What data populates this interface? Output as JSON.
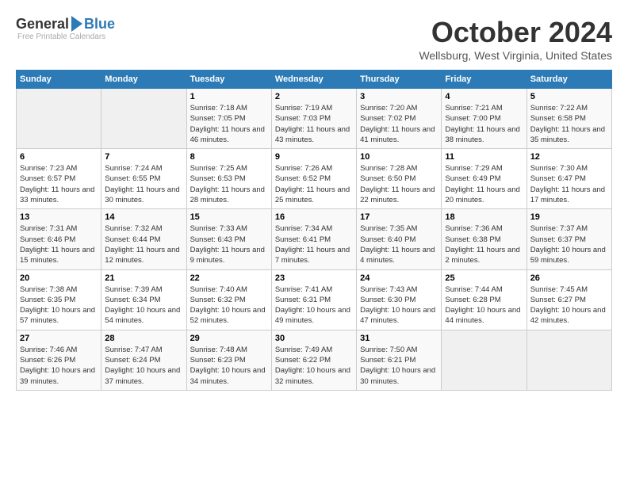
{
  "logo": {
    "general": "General",
    "blue": "Blue",
    "tagline": "Free Printable Calendars"
  },
  "header": {
    "month": "October 2024",
    "location": "Wellsburg, West Virginia, United States"
  },
  "columns": [
    "Sunday",
    "Monday",
    "Tuesday",
    "Wednesday",
    "Thursday",
    "Friday",
    "Saturday"
  ],
  "weeks": [
    [
      {
        "day": "",
        "sunrise": "",
        "sunset": "",
        "daylight": "",
        "empty": true
      },
      {
        "day": "",
        "sunrise": "",
        "sunset": "",
        "daylight": "",
        "empty": true
      },
      {
        "day": "1",
        "sunrise": "Sunrise: 7:18 AM",
        "sunset": "Sunset: 7:05 PM",
        "daylight": "Daylight: 11 hours and 46 minutes."
      },
      {
        "day": "2",
        "sunrise": "Sunrise: 7:19 AM",
        "sunset": "Sunset: 7:03 PM",
        "daylight": "Daylight: 11 hours and 43 minutes."
      },
      {
        "day": "3",
        "sunrise": "Sunrise: 7:20 AM",
        "sunset": "Sunset: 7:02 PM",
        "daylight": "Daylight: 11 hours and 41 minutes."
      },
      {
        "day": "4",
        "sunrise": "Sunrise: 7:21 AM",
        "sunset": "Sunset: 7:00 PM",
        "daylight": "Daylight: 11 hours and 38 minutes."
      },
      {
        "day": "5",
        "sunrise": "Sunrise: 7:22 AM",
        "sunset": "Sunset: 6:58 PM",
        "daylight": "Daylight: 11 hours and 35 minutes."
      }
    ],
    [
      {
        "day": "6",
        "sunrise": "Sunrise: 7:23 AM",
        "sunset": "Sunset: 6:57 PM",
        "daylight": "Daylight: 11 hours and 33 minutes."
      },
      {
        "day": "7",
        "sunrise": "Sunrise: 7:24 AM",
        "sunset": "Sunset: 6:55 PM",
        "daylight": "Daylight: 11 hours and 30 minutes."
      },
      {
        "day": "8",
        "sunrise": "Sunrise: 7:25 AM",
        "sunset": "Sunset: 6:53 PM",
        "daylight": "Daylight: 11 hours and 28 minutes."
      },
      {
        "day": "9",
        "sunrise": "Sunrise: 7:26 AM",
        "sunset": "Sunset: 6:52 PM",
        "daylight": "Daylight: 11 hours and 25 minutes."
      },
      {
        "day": "10",
        "sunrise": "Sunrise: 7:28 AM",
        "sunset": "Sunset: 6:50 PM",
        "daylight": "Daylight: 11 hours and 22 minutes."
      },
      {
        "day": "11",
        "sunrise": "Sunrise: 7:29 AM",
        "sunset": "Sunset: 6:49 PM",
        "daylight": "Daylight: 11 hours and 20 minutes."
      },
      {
        "day": "12",
        "sunrise": "Sunrise: 7:30 AM",
        "sunset": "Sunset: 6:47 PM",
        "daylight": "Daylight: 11 hours and 17 minutes."
      }
    ],
    [
      {
        "day": "13",
        "sunrise": "Sunrise: 7:31 AM",
        "sunset": "Sunset: 6:46 PM",
        "daylight": "Daylight: 11 hours and 15 minutes."
      },
      {
        "day": "14",
        "sunrise": "Sunrise: 7:32 AM",
        "sunset": "Sunset: 6:44 PM",
        "daylight": "Daylight: 11 hours and 12 minutes."
      },
      {
        "day": "15",
        "sunrise": "Sunrise: 7:33 AM",
        "sunset": "Sunset: 6:43 PM",
        "daylight": "Daylight: 11 hours and 9 minutes."
      },
      {
        "day": "16",
        "sunrise": "Sunrise: 7:34 AM",
        "sunset": "Sunset: 6:41 PM",
        "daylight": "Daylight: 11 hours and 7 minutes."
      },
      {
        "day": "17",
        "sunrise": "Sunrise: 7:35 AM",
        "sunset": "Sunset: 6:40 PM",
        "daylight": "Daylight: 11 hours and 4 minutes."
      },
      {
        "day": "18",
        "sunrise": "Sunrise: 7:36 AM",
        "sunset": "Sunset: 6:38 PM",
        "daylight": "Daylight: 11 hours and 2 minutes."
      },
      {
        "day": "19",
        "sunrise": "Sunrise: 7:37 AM",
        "sunset": "Sunset: 6:37 PM",
        "daylight": "Daylight: 10 hours and 59 minutes."
      }
    ],
    [
      {
        "day": "20",
        "sunrise": "Sunrise: 7:38 AM",
        "sunset": "Sunset: 6:35 PM",
        "daylight": "Daylight: 10 hours and 57 minutes."
      },
      {
        "day": "21",
        "sunrise": "Sunrise: 7:39 AM",
        "sunset": "Sunset: 6:34 PM",
        "daylight": "Daylight: 10 hours and 54 minutes."
      },
      {
        "day": "22",
        "sunrise": "Sunrise: 7:40 AM",
        "sunset": "Sunset: 6:32 PM",
        "daylight": "Daylight: 10 hours and 52 minutes."
      },
      {
        "day": "23",
        "sunrise": "Sunrise: 7:41 AM",
        "sunset": "Sunset: 6:31 PM",
        "daylight": "Daylight: 10 hours and 49 minutes."
      },
      {
        "day": "24",
        "sunrise": "Sunrise: 7:43 AM",
        "sunset": "Sunset: 6:30 PM",
        "daylight": "Daylight: 10 hours and 47 minutes."
      },
      {
        "day": "25",
        "sunrise": "Sunrise: 7:44 AM",
        "sunset": "Sunset: 6:28 PM",
        "daylight": "Daylight: 10 hours and 44 minutes."
      },
      {
        "day": "26",
        "sunrise": "Sunrise: 7:45 AM",
        "sunset": "Sunset: 6:27 PM",
        "daylight": "Daylight: 10 hours and 42 minutes."
      }
    ],
    [
      {
        "day": "27",
        "sunrise": "Sunrise: 7:46 AM",
        "sunset": "Sunset: 6:26 PM",
        "daylight": "Daylight: 10 hours and 39 minutes."
      },
      {
        "day": "28",
        "sunrise": "Sunrise: 7:47 AM",
        "sunset": "Sunset: 6:24 PM",
        "daylight": "Daylight: 10 hours and 37 minutes."
      },
      {
        "day": "29",
        "sunrise": "Sunrise: 7:48 AM",
        "sunset": "Sunset: 6:23 PM",
        "daylight": "Daylight: 10 hours and 34 minutes."
      },
      {
        "day": "30",
        "sunrise": "Sunrise: 7:49 AM",
        "sunset": "Sunset: 6:22 PM",
        "daylight": "Daylight: 10 hours and 32 minutes."
      },
      {
        "day": "31",
        "sunrise": "Sunrise: 7:50 AM",
        "sunset": "Sunset: 6:21 PM",
        "daylight": "Daylight: 10 hours and 30 minutes."
      },
      {
        "day": "",
        "sunrise": "",
        "sunset": "",
        "daylight": "",
        "empty": true
      },
      {
        "day": "",
        "sunrise": "",
        "sunset": "",
        "daylight": "",
        "empty": true
      }
    ]
  ]
}
